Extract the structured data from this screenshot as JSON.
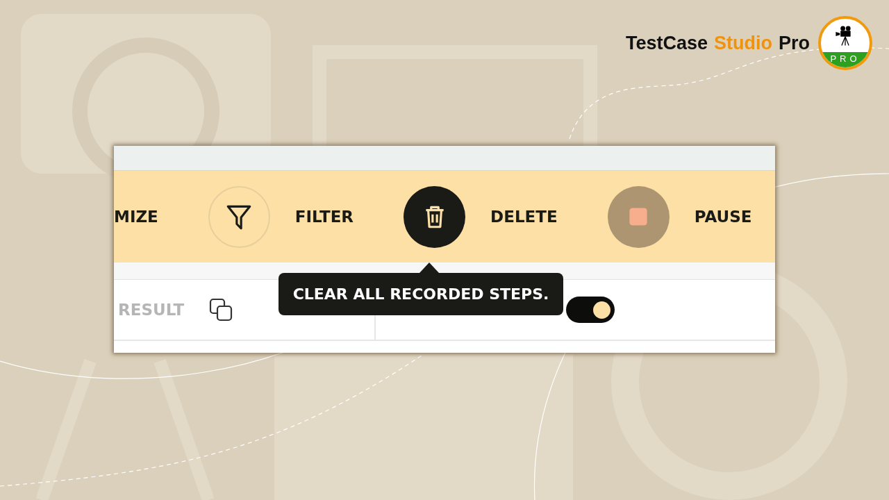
{
  "brand": {
    "words": [
      {
        "text": "TestCase",
        "highlight": false
      },
      {
        "text": "Studio",
        "highlight": true
      },
      {
        "text": "Pro",
        "highlight": false
      }
    ],
    "logo_text": "PRO"
  },
  "toolbar": {
    "items": [
      {
        "kind": "text",
        "label": "MIZE"
      },
      {
        "kind": "filter",
        "label": "FILTER",
        "hovered": false
      },
      {
        "kind": "delete",
        "label": "DELETE",
        "hovered": true
      },
      {
        "kind": "pause",
        "label": "PAUSE",
        "hovered": false
      }
    ],
    "tooltip": "CLEAR ALL RECORDED STEPS."
  },
  "row": {
    "result_label": "RESULT",
    "screenshots_toggle": {
      "on": true
    }
  }
}
